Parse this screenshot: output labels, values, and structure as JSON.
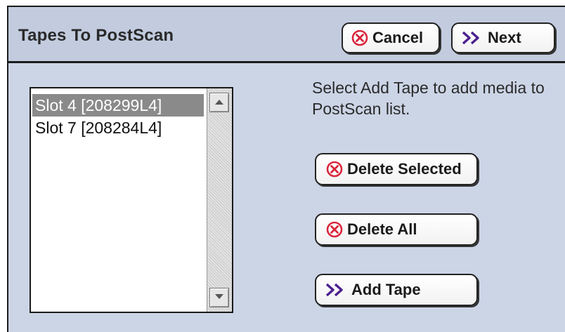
{
  "header": {
    "title": "Tapes To PostScan",
    "cancel_label": "Cancel",
    "next_label": "Next"
  },
  "tape_list": {
    "items": [
      {
        "label": "Slot 4 [208299L4]",
        "selected": true
      },
      {
        "label": "Slot 7 [208284L4]",
        "selected": false
      }
    ]
  },
  "instructions": "Select Add Tape to add media to PostScan list.",
  "actions": {
    "delete_selected_label": "Delete Selected",
    "delete_all_label": "Delete All",
    "add_tape_label": "Add Tape"
  },
  "icons": {
    "cancel": "circle-x-icon",
    "next": "double-chevron-right-icon",
    "scroll_up": "triangle-up-icon",
    "scroll_down": "triangle-down-icon"
  },
  "colors": {
    "panel_bg": "#ccd5e6",
    "header_bg": "#c3ccdf",
    "cancel_icon": "#d9263b",
    "next_icon": "#4b1f8e",
    "selected_row_bg": "#8a8a8a"
  }
}
